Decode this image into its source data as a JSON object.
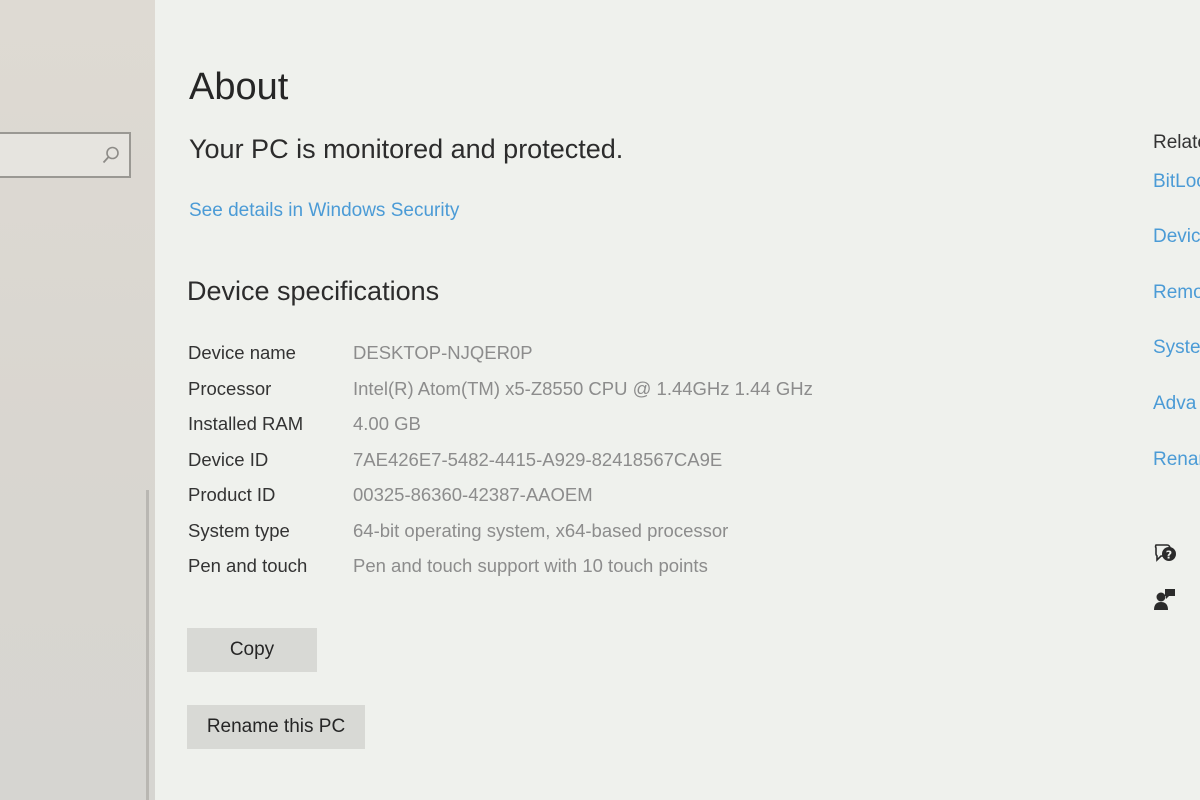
{
  "sidebar": {
    "search": {
      "placeholder": "",
      "value": ""
    }
  },
  "main": {
    "title": "About",
    "status": "Your PC is monitored and protected.",
    "security_link": "See details in Windows Security",
    "specs_heading": "Device specifications",
    "specs": [
      {
        "label": "Device name",
        "value": "DESKTOP-NJQER0P"
      },
      {
        "label": "Processor",
        "value": "Intel(R) Atom(TM) x5-Z8550  CPU @ 1.44GHz   1.44 GHz"
      },
      {
        "label": "Installed RAM",
        "value": "4.00 GB"
      },
      {
        "label": "Device ID",
        "value": "7AE426E7-5482-4415-A929-82418567CA9E"
      },
      {
        "label": "Product ID",
        "value": "00325-86360-42387-AAOEM"
      },
      {
        "label": "System type",
        "value": "64-bit operating system, x64-based processor"
      },
      {
        "label": "Pen and touch",
        "value": "Pen and touch support with 10 touch points"
      }
    ],
    "copy_label": "Copy",
    "rename_label": "Rename this PC"
  },
  "related": {
    "title": "Relate",
    "links": [
      "BitLoc",
      "Devic",
      "Remo",
      "Syste",
      "Adva",
      "Renar"
    ],
    "icons": [
      "help-icon",
      "feedback-icon"
    ]
  },
  "colors": {
    "link": "#4b9bd6",
    "spec_value": "#8c8c8c",
    "button_bg": "#d8d9d5",
    "background": "#eff1ed"
  }
}
